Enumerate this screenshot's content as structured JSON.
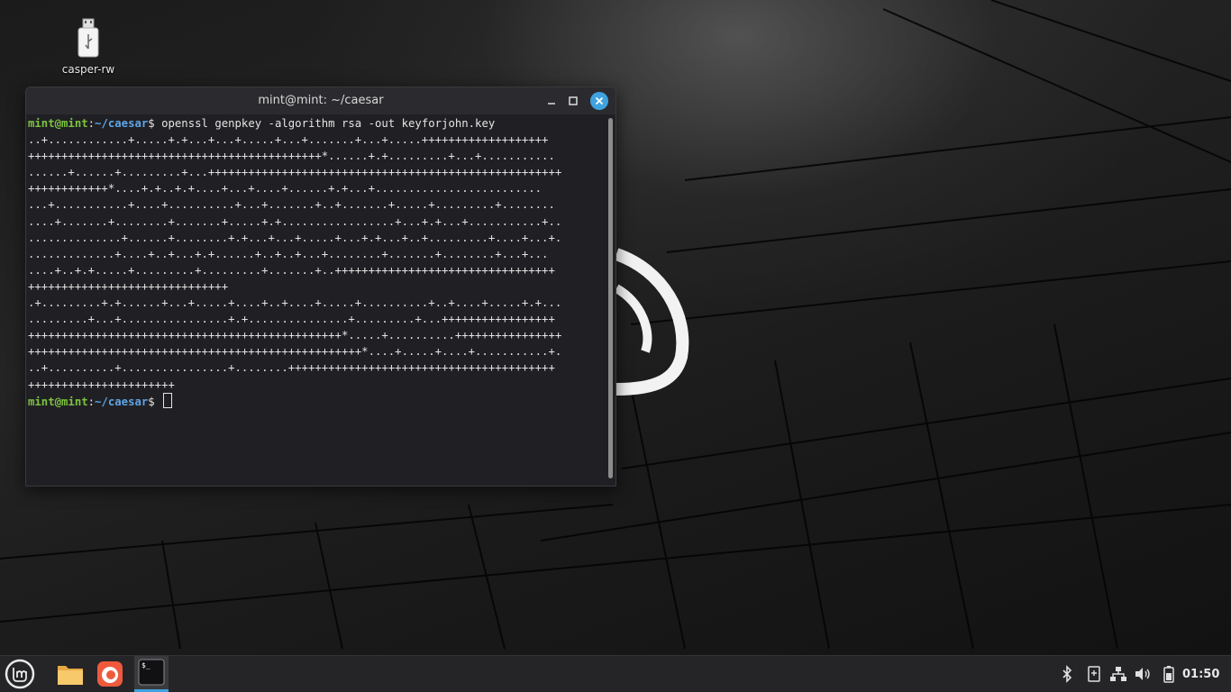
{
  "desktop": {
    "icons": [
      {
        "label": "casper-rw",
        "icon": "usb-drive-icon"
      }
    ]
  },
  "terminal": {
    "title": "mint@mint: ~/caesar",
    "prompt_user": "mint@mint",
    "prompt_sep": ":",
    "prompt_path": "~/caesar",
    "prompt_symbol": "$ ",
    "command": "openssl genpkey -algorithm rsa -out keyforjohn.key",
    "output_lines": [
      "..+............+.....+.+...+...+.....+...+.......+...+.....+++++++++++++++++++",
      "++++++++++++++++++++++++++++++++++++++++++++*......+.+.........+...+...........",
      "......+......+.........+...+++++++++++++++++++++++++++++++++++++++++++++++++++++",
      "++++++++++++*....+.+..+.+....+...+....+......+.+...+.........................",
      "...+...........+....+..........+...+.......+..+.......+.....+.........+........",
      "....+.......+........+.......+.....+.+.................+...+.+...+...........+..",
      "..............+......+........+.+...+...+.....+...+.+...+..+.........+....+...+.",
      ".............+....+..+...+.+......+..+..+...+........+.......+........+...+...",
      "....+..+.+.....+.........+.........+.......+..+++++++++++++++++++++++++++++++++",
      "++++++++++++++++++++++++++++++",
      ".+.........+.+......+...+.....+....+..+....+.....+..........+..+....+.....+.+...",
      ".........+...+................+.+...............+.........+...+++++++++++++++++",
      "+++++++++++++++++++++++++++++++++++++++++++++++*.....+..........++++++++++++++++",
      "++++++++++++++++++++++++++++++++++++++++++++++++++*....+.....+....+...........+.",
      "..+..........+................+........++++++++++++++++++++++++++++++++++++++++",
      "++++++++++++++++++++++"
    ]
  },
  "taskbar": {
    "launchers": [
      {
        "name": "menu",
        "icon": "linux-mint-menu-icon"
      },
      {
        "name": "files",
        "icon": "folder-icon"
      },
      {
        "name": "firefox",
        "icon": "firefox-icon"
      },
      {
        "name": "terminal",
        "icon": "terminal-icon",
        "active": true
      }
    ],
    "tray": [
      "bluetooth-icon",
      "notes-icon",
      "network-icon",
      "volume-icon",
      "battery-icon"
    ],
    "clock": "01:50"
  },
  "colors": {
    "accent": "#3fa3e0",
    "prompt_user": "#7dc33e",
    "prompt_path": "#5fa4e6",
    "terminal_bg": "#202024",
    "taskbar_bg": "#252527"
  }
}
